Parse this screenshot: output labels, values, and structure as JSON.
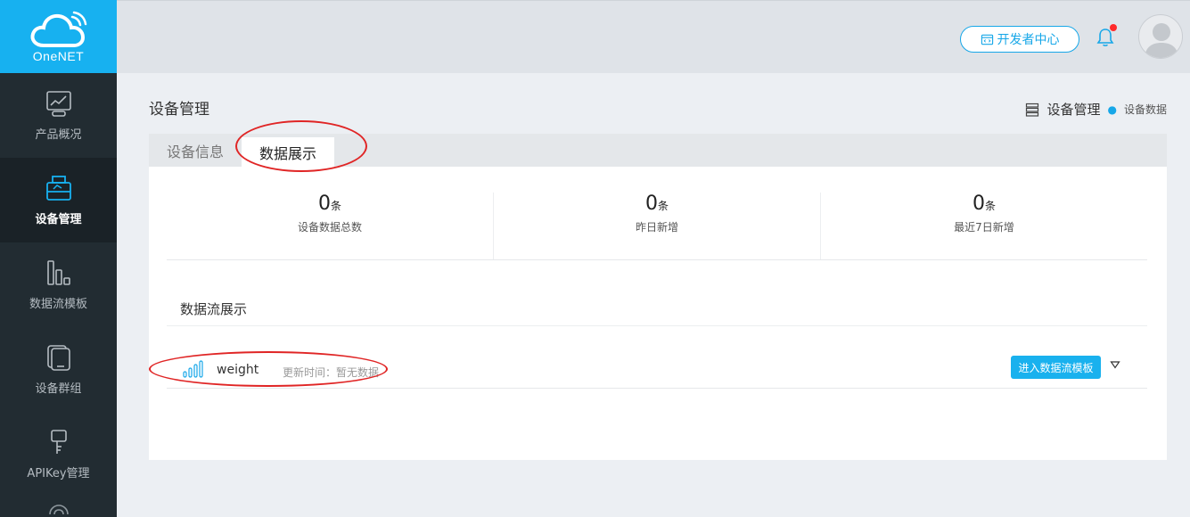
{
  "brand": {
    "logo_text": "OneNET",
    "color": "#17b1f0"
  },
  "sidebar": {
    "items": [
      {
        "label": "产品概况",
        "icon": "chart-icon"
      },
      {
        "label": "设备管理",
        "icon": "device-icon",
        "active": true
      },
      {
        "label": "数据流模板",
        "icon": "bars-icon"
      },
      {
        "label": "设备群组",
        "icon": "group-icon"
      },
      {
        "label": "APIKey管理",
        "icon": "key-icon"
      }
    ]
  },
  "topbar": {
    "developer_center": "开发者中心",
    "notification_dot_color": "#ff2a2a"
  },
  "page": {
    "title": "设备管理",
    "breadcrumb": {
      "parent": "设备管理",
      "current": "设备数据"
    }
  },
  "tabs": [
    {
      "label": "设备信息",
      "active": false
    },
    {
      "label": "数据展示",
      "active": true
    }
  ],
  "stats": [
    {
      "value": "0",
      "unit": "条",
      "label": "设备数据总数"
    },
    {
      "value": "0",
      "unit": "条",
      "label": "昨日新增"
    },
    {
      "value": "0",
      "unit": "条",
      "label": "最近7日新增"
    }
  ],
  "streams": {
    "title": "数据流展示",
    "items": [
      {
        "name": "weight",
        "update_time": "更新时间：暂无数据",
        "button": "进入数据流模板"
      }
    ]
  },
  "accent_color": "#17a7e8",
  "annotation_color": "#e02525"
}
